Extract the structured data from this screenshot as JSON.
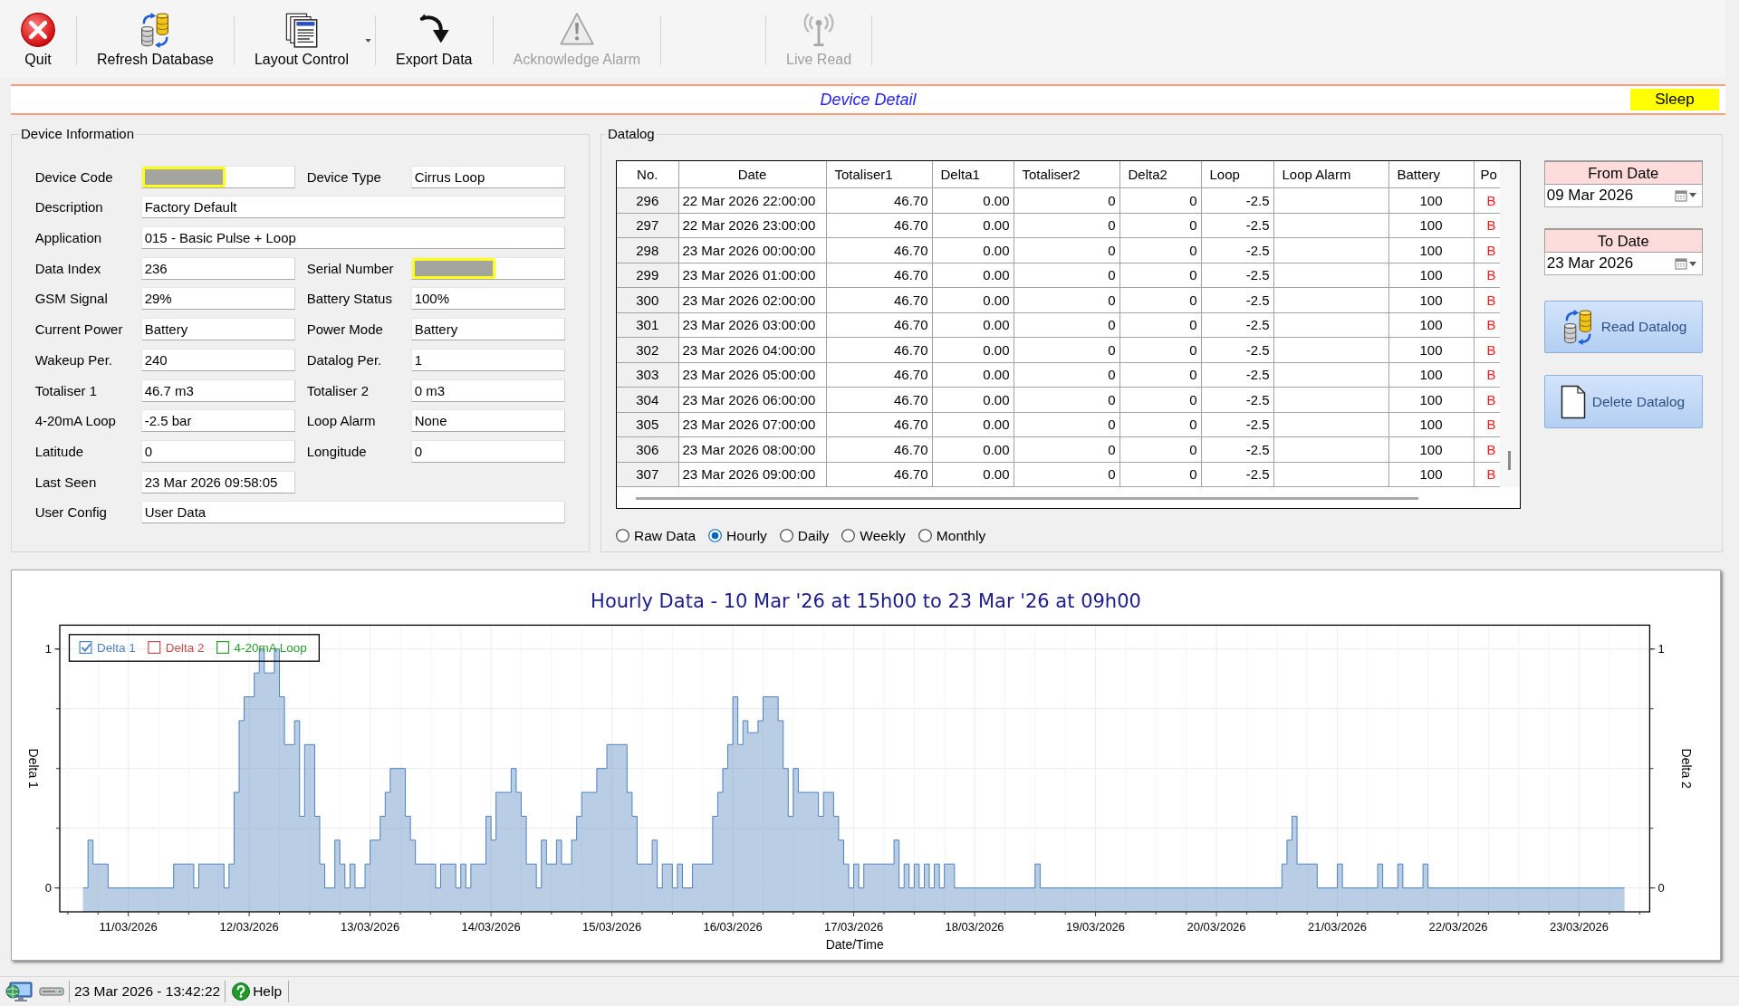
{
  "toolbar": [
    {
      "kind": "button",
      "label": "Quit",
      "disabled": false
    },
    {
      "kind": "button",
      "label": "Refresh Database",
      "disabled": false
    },
    {
      "kind": "dropdown",
      "label": "Layout Control",
      "disabled": false
    },
    {
      "kind": "button",
      "label": "Export Data",
      "disabled": false
    },
    {
      "kind": "button",
      "label": "Acknowledge Alarm",
      "disabled": true
    },
    {
      "kind": "spacer"
    },
    {
      "kind": "button",
      "label": "Live Read",
      "disabled": true
    }
  ],
  "header": {
    "title": "Device Detail",
    "status": "Sleep"
  },
  "device_information": {
    "title": "Device Information",
    "fields": [
      {
        "kind": "half",
        "label": "Device Code",
        "redacted": true
      },
      {
        "kind": "half",
        "label": "Device Type",
        "value": "Cirrus Loop",
        "redacted": false
      },
      {
        "kind": "wide",
        "label": "Description",
        "value": "Factory Default",
        "redacted": false
      },
      {
        "kind": "wide",
        "label": "Application",
        "value": "015 - Basic Pulse + Loop",
        "redacted": false
      },
      {
        "kind": "half",
        "label": "Data Index",
        "value": "236",
        "redacted": false
      },
      {
        "kind": "half",
        "label": "Serial Number",
        "redacted": true
      },
      {
        "kind": "half",
        "label": "GSM Signal",
        "value": "29%",
        "redacted": false
      },
      {
        "kind": "half",
        "label": "Battery Status",
        "value": "100%",
        "redacted": false
      },
      {
        "kind": "half",
        "label": "Current Power",
        "value": "Battery",
        "redacted": false
      },
      {
        "kind": "half",
        "label": "Power Mode",
        "value": "Battery",
        "redacted": false
      },
      {
        "kind": "half",
        "label": "Wakeup Per.",
        "value": "240",
        "redacted": false
      },
      {
        "kind": "half",
        "label": "Datalog Per.",
        "value": "1",
        "redacted": false
      },
      {
        "kind": "half",
        "label": "Totaliser 1",
        "value": "46.7 m3",
        "redacted": false
      },
      {
        "kind": "half",
        "label": "Totaliser 2",
        "value": "0 m3",
        "redacted": false
      },
      {
        "kind": "half",
        "label": "4-20mA Loop",
        "value": "-2.5 bar",
        "redacted": false
      },
      {
        "kind": "half",
        "label": "Loop Alarm",
        "value": "None",
        "redacted": false
      },
      {
        "kind": "half",
        "label": "Latitude",
        "value": "0",
        "redacted": false
      },
      {
        "kind": "half",
        "label": "Longitude",
        "value": "0",
        "redacted": false
      },
      {
        "kind": "half",
        "label": "Last Seen",
        "value": "23 Mar 2026 09:58:05",
        "redacted": false
      },
      {
        "kind": "wide",
        "label": "User Config",
        "value": "User Data",
        "redacted": false
      }
    ]
  },
  "datalog": {
    "title": "Datalog",
    "table": {
      "columns": [
        "No.",
        "Date",
        "Totaliser1",
        "Delta1",
        "Totaliser2",
        "Delta2",
        "Loop",
        "Loop Alarm",
        "Battery",
        "Po"
      ],
      "rows": [
        [
          "296",
          "22 Mar 2026 22:00:00",
          "46.70",
          "0.00",
          "0",
          "0",
          "-2.5",
          null,
          "100",
          "B"
        ],
        [
          "297",
          "22 Mar 2026 23:00:00",
          "46.70",
          "0.00",
          "0",
          "0",
          "-2.5",
          null,
          "100",
          "B"
        ],
        [
          "298",
          "23 Mar 2026 00:00:00",
          "46.70",
          "0.00",
          "0",
          "0",
          "-2.5",
          null,
          "100",
          "B"
        ],
        [
          "299",
          "23 Mar 2026 01:00:00",
          "46.70",
          "0.00",
          "0",
          "0",
          "-2.5",
          null,
          "100",
          "B"
        ],
        [
          "300",
          "23 Mar 2026 02:00:00",
          "46.70",
          "0.00",
          "0",
          "0",
          "-2.5",
          null,
          "100",
          "B"
        ],
        [
          "301",
          "23 Mar 2026 03:00:00",
          "46.70",
          "0.00",
          "0",
          "0",
          "-2.5",
          null,
          "100",
          "B"
        ],
        [
          "302",
          "23 Mar 2026 04:00:00",
          "46.70",
          "0.00",
          "0",
          "0",
          "-2.5",
          null,
          "100",
          "B"
        ],
        [
          "303",
          "23 Mar 2026 05:00:00",
          "46.70",
          "0.00",
          "0",
          "0",
          "-2.5",
          null,
          "100",
          "B"
        ],
        [
          "304",
          "23 Mar 2026 06:00:00",
          "46.70",
          "0.00",
          "0",
          "0",
          "-2.5",
          null,
          "100",
          "B"
        ],
        [
          "305",
          "23 Mar 2026 07:00:00",
          "46.70",
          "0.00",
          "0",
          "0",
          "-2.5",
          null,
          "100",
          "B"
        ],
        [
          "306",
          "23 Mar 2026 08:00:00",
          "46.70",
          "0.00",
          "0",
          "0",
          "-2.5",
          null,
          "100",
          "B"
        ],
        [
          "307",
          "23 Mar 2026 09:00:00",
          "46.70",
          "0.00",
          "0",
          "0",
          "-2.5",
          null,
          "100",
          "B"
        ]
      ]
    },
    "from_date": {
      "label": "From Date",
      "value": "09 Mar 2026"
    },
    "to_date": {
      "label": "To Date",
      "value": "23 Mar 2026"
    },
    "buttons": [
      "Read Datalog",
      "Delete Datalog"
    ],
    "views": [
      {
        "label": "Raw Data",
        "selected": false
      },
      {
        "label": "Hourly",
        "selected": true
      },
      {
        "label": "Daily",
        "selected": false
      },
      {
        "label": "Weekly",
        "selected": false
      },
      {
        "label": "Monthly",
        "selected": false
      }
    ]
  },
  "chart": {
    "chart_data": {
      "type": "area",
      "title": "Hourly Data - 10 Mar '26 at 15h00 to 23 Mar '26 at 09h00",
      "xlabel": "Date/Time",
      "ylabel": "Delta 1",
      "categories": [
        null,
        null,
        null,
        null,
        null,
        null,
        null,
        null,
        null,
        "11/03/2026",
        null,
        null,
        null,
        null,
        null,
        null,
        null,
        null,
        null,
        null,
        null,
        null,
        null,
        null,
        null,
        null,
        null,
        null,
        null,
        null,
        null,
        null,
        null,
        "12/03/2026",
        null,
        null,
        null,
        null,
        null,
        null,
        null,
        null,
        null,
        null,
        null,
        null,
        null,
        null,
        null,
        null,
        null,
        null,
        null,
        null,
        null,
        null,
        null,
        "13/03/2026",
        null,
        null,
        null,
        null,
        null,
        null,
        null,
        null,
        null,
        null,
        null,
        null,
        null,
        null,
        null,
        null,
        null,
        null,
        null,
        null,
        null,
        null,
        null,
        "14/03/2026",
        null,
        null,
        null,
        null,
        null,
        null,
        null,
        null,
        null,
        null,
        null,
        null,
        null,
        null,
        null,
        null,
        null,
        null,
        null,
        null,
        null,
        null,
        null,
        "15/03/2026",
        null,
        null,
        null,
        null,
        null,
        null,
        null,
        null,
        null,
        null,
        null,
        null,
        null,
        null,
        null,
        null,
        null,
        null,
        null,
        null,
        null,
        null,
        null,
        "16/03/2026",
        null,
        null,
        null,
        null,
        null,
        null,
        null,
        null,
        null,
        null,
        null,
        null,
        null,
        null,
        null,
        null,
        null,
        null,
        null,
        null,
        null,
        null,
        null,
        "17/03/2026",
        null,
        null,
        null,
        null,
        null,
        null,
        null,
        null,
        null,
        null,
        null,
        null,
        null,
        null,
        null,
        null,
        null,
        null,
        null,
        null,
        null,
        null,
        null,
        "18/03/2026",
        null,
        null,
        null,
        null,
        null,
        null,
        null,
        null,
        null,
        null,
        null,
        null,
        null,
        null,
        null,
        null,
        null,
        null,
        null,
        null,
        null,
        null,
        null,
        "19/03/2026",
        null,
        null,
        null,
        null,
        null,
        null,
        null,
        null,
        null,
        null,
        null,
        null,
        null,
        null,
        null,
        null,
        null,
        null,
        null,
        null,
        null,
        null,
        null,
        "20/03/2026",
        null,
        null,
        null,
        null,
        null,
        null,
        null,
        null,
        null,
        null,
        null,
        null,
        null,
        null,
        null,
        null,
        null,
        null,
        null,
        null,
        null,
        null,
        null,
        "21/03/2026",
        null,
        null,
        null,
        null,
        null,
        null,
        null,
        null,
        null,
        null,
        null,
        null,
        null,
        null,
        null,
        null,
        null,
        null,
        null,
        null,
        null,
        null,
        null,
        "22/03/2026",
        null,
        null,
        null,
        null,
        null,
        null,
        null,
        null,
        null,
        null,
        null,
        null,
        null,
        null,
        null,
        null,
        null,
        null,
        null,
        null,
        null,
        null,
        null,
        "23/03/2026",
        null,
        null,
        null,
        null,
        null,
        null,
        null,
        null,
        null
      ],
      "series": [
        {
          "name": "Delta 1",
          "color": "#4f81bd",
          "values": [
            0,
            0.2,
            0.1,
            0.1,
            0.1,
            0,
            0,
            0,
            0,
            0,
            0,
            0,
            0,
            0,
            0,
            0,
            0,
            0,
            0.1,
            0.1,
            0.1,
            0.1,
            0,
            0.1,
            0.1,
            0.1,
            0.1,
            0.1,
            0,
            0.1,
            0.4,
            0.7,
            0.8,
            0.8,
            0.9,
            1,
            0.9,
            0.9,
            1,
            0.8,
            0.6,
            0.6,
            0.7,
            0.3,
            0.6,
            0.6,
            0.3,
            0.1,
            0,
            0,
            0.2,
            0.1,
            0,
            0.1,
            0,
            0,
            0.1,
            0.2,
            0.2,
            0.3,
            0.4,
            0.5,
            0.5,
            0.5,
            0.3,
            0.2,
            0.1,
            0.1,
            0.1,
            0.1,
            0,
            0.1,
            0.1,
            0.1,
            0,
            0.1,
            0,
            0.1,
            0.1,
            0.1,
            0.3,
            0.2,
            0.4,
            0.4,
            0.4,
            0.5,
            0.4,
            0.3,
            0.1,
            0.1,
            0,
            0.2,
            0.1,
            0.1,
            0.2,
            0.1,
            0.1,
            0.2,
            0.3,
            0.4,
            0.4,
            0.4,
            0.5,
            0.5,
            0.6,
            0.6,
            0.6,
            0.6,
            0.4,
            0.3,
            0.1,
            0.1,
            0.1,
            0.2,
            0,
            0.1,
            0.1,
            0,
            0.1,
            0,
            0,
            0.1,
            0.1,
            0.1,
            0.1,
            0.3,
            0.4,
            0.5,
            0.6,
            0.8,
            0.6,
            0.7,
            0.65,
            0.65,
            0.7,
            0.8,
            0.8,
            0.8,
            0.7,
            0.5,
            0.3,
            0.5,
            0.4,
            0.4,
            0.4,
            0.4,
            0.3,
            0.4,
            0.4,
            0.3,
            0.2,
            0.1,
            0,
            0.1,
            0,
            0.1,
            0.1,
            0.1,
            0.1,
            0.1,
            0.1,
            0.2,
            0,
            0.1,
            0,
            0.1,
            0,
            0.1,
            0,
            0.1,
            0,
            0.1,
            0.1,
            0,
            0,
            0,
            0,
            0,
            0,
            0,
            0,
            0,
            0,
            0,
            0,
            0,
            0,
            0,
            0,
            0.1,
            0,
            0,
            0,
            0,
            0,
            0,
            0,
            0,
            0,
            0,
            0,
            0,
            0,
            0,
            0,
            0,
            0,
            0,
            0,
            0,
            0,
            0,
            0,
            0,
            0,
            0,
            0,
            0,
            0,
            0,
            0,
            0,
            0,
            0,
            0,
            0,
            0,
            0,
            0,
            0,
            0,
            0,
            0,
            0,
            0,
            0,
            0,
            0,
            0.1,
            0.2,
            0.3,
            0.1,
            0.1,
            0.1,
            0.1,
            0,
            0,
            0,
            0,
            0.1,
            0,
            0,
            0,
            0,
            0,
            0,
            0,
            0.1,
            0,
            0,
            0,
            0.1,
            0,
            0,
            0,
            0,
            0.1,
            0,
            0,
            0,
            0,
            0,
            0,
            0,
            0,
            0,
            0,
            0,
            0,
            0,
            0,
            0,
            0,
            0,
            0,
            0,
            0,
            0,
            0,
            0,
            0,
            0,
            0,
            0,
            0,
            0,
            0,
            0,
            0,
            0,
            0,
            0,
            0,
            0,
            0,
            0,
            0
          ]
        }
      ],
      "ylim": [
        -0.1,
        1.1
      ],
      "yticks": [
        {
          "value": 1,
          "label": "1"
        },
        {
          "value": 0,
          "label": "0"
        }
      ]
    },
    "legend": [
      {
        "checked": true
      },
      {
        "label": "Delta 2",
        "color": "#c0504d",
        "checked": false
      },
      {
        "label": "4-20mA Loop",
        "color": "#2a9d2a",
        "checked": false
      }
    ],
    "right_axis": {
      "label": "Delta 2",
      "ticks": [
        "1",
        "0"
      ]
    }
  },
  "status_bar": {
    "datetime": "23 Mar 2026 - 13:42:22",
    "help": "Help"
  }
}
